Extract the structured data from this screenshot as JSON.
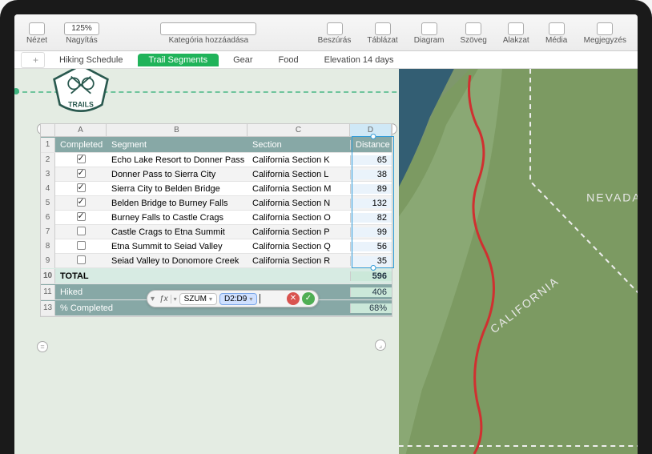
{
  "toolbar": {
    "view": "Nézet",
    "zoom_label": "Nagyítás",
    "zoom_value": "125%",
    "category": "Kategória hozzáadása",
    "insert": "Beszúrás",
    "table": "Táblázat",
    "chart": "Diagram",
    "text": "Szöveg",
    "shape": "Alakzat",
    "media": "Média",
    "comment": "Megjegyzés"
  },
  "tabs": {
    "hiking": "Hiking Schedule",
    "segments": "Trail Segments",
    "gear": "Gear",
    "food": "Food",
    "elevation": "Elevation 14 days"
  },
  "badge": {
    "text": "TRAILS"
  },
  "columns": {
    "A": "A",
    "B": "B",
    "C": "C",
    "D": "D"
  },
  "headers": {
    "completed": "Completed",
    "segment": "Segment",
    "section": "Section",
    "distance": "Distance"
  },
  "rows": [
    {
      "n": "2",
      "done": true,
      "seg": "Echo Lake Resort to Donner Pass",
      "sec": "California Section K",
      "dist": "65"
    },
    {
      "n": "3",
      "done": true,
      "seg": "Donner Pass to Sierra City",
      "sec": "California Section L",
      "dist": "38"
    },
    {
      "n": "4",
      "done": true,
      "seg": "Sierra City to Belden Bridge",
      "sec": "California Section M",
      "dist": "89"
    },
    {
      "n": "5",
      "done": true,
      "seg": "Belden Bridge to Burney Falls",
      "sec": "California Section N",
      "dist": "132"
    },
    {
      "n": "6",
      "done": true,
      "seg": "Burney Falls to Castle Crags",
      "sec": "California Section O",
      "dist": "82"
    },
    {
      "n": "7",
      "done": false,
      "seg": "Castle Crags to Etna Summit",
      "sec": "California Section P",
      "dist": "99"
    },
    {
      "n": "8",
      "done": false,
      "seg": "Etna Summit to Seiad Valley",
      "sec": "California Section Q",
      "dist": "56"
    },
    {
      "n": "9",
      "done": false,
      "seg": "Seiad Valley to Donomore Creek",
      "sec": "California Section R",
      "dist": "35"
    }
  ],
  "totals": {
    "label": "TOTAL",
    "value": "596",
    "n": "10"
  },
  "hiked": {
    "label": "Hiked",
    "value": "406",
    "n": "11"
  },
  "pct": {
    "label": "% Completed",
    "value": "68%",
    "n": "13"
  },
  "formula": {
    "fn": "SZUM",
    "ref": "D2:D9"
  },
  "map": {
    "california": "CALIFORNIA",
    "nevada": "NEVADA"
  }
}
